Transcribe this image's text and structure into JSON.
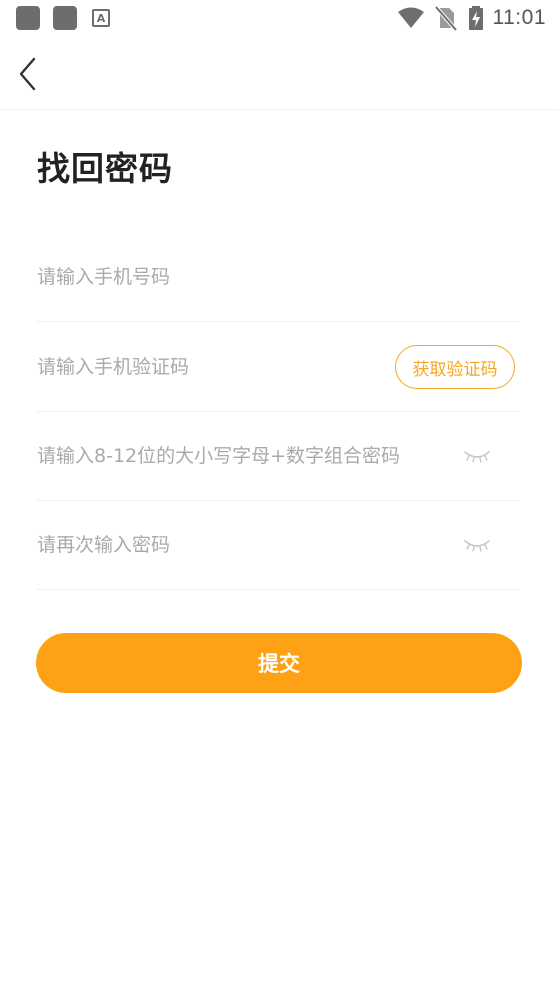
{
  "status_bar": {
    "time": "11:01",
    "icons": [
      "notification-square-icon",
      "notification-square-icon",
      "accessibility-a-icon",
      "wifi-icon",
      "no-sim-icon",
      "battery-charging-icon"
    ]
  },
  "header": {
    "back_icon": "chevron-left-icon"
  },
  "page": {
    "title": "找回密码"
  },
  "form": {
    "phone": {
      "placeholder": "请输入手机号码",
      "value": ""
    },
    "sms_code": {
      "placeholder": "请输入手机验证码",
      "value": "",
      "button_label": "获取验证码"
    },
    "password": {
      "placeholder": "请输入8-12位的大小写字母+数字组合密码",
      "value": "",
      "toggle_icon": "eye-closed-icon"
    },
    "confirm_password": {
      "placeholder": "请再次输入密码",
      "value": "",
      "toggle_icon": "eye-closed-icon"
    },
    "submit_label": "提交"
  },
  "colors": {
    "accent": "#ffa114",
    "accent_border": "#f5a623",
    "placeholder": "#aaaaaa",
    "title": "#222222"
  }
}
